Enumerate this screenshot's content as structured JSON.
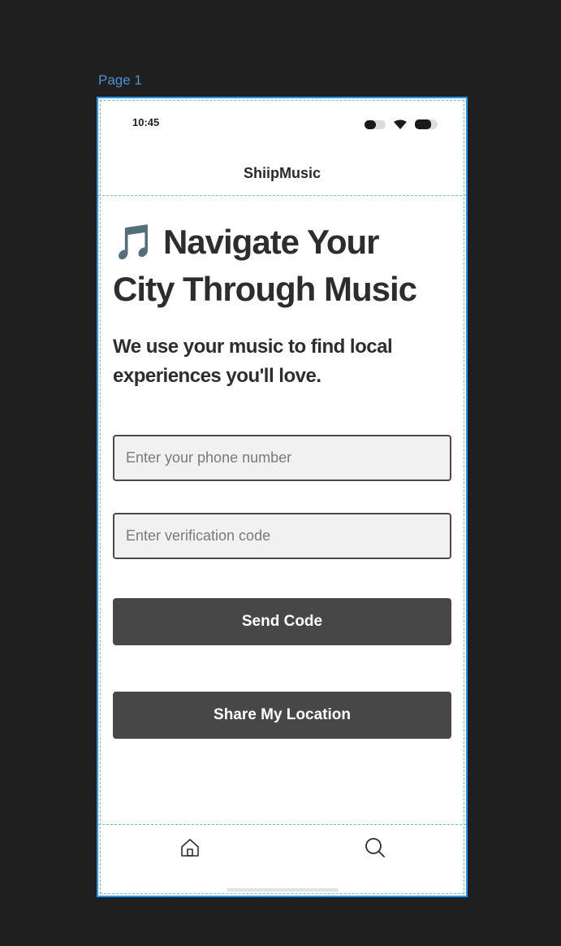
{
  "canvas": {
    "page_label": "Page 1"
  },
  "status_bar": {
    "time": "10:45",
    "icons": [
      "signal-icon",
      "wifi-icon",
      "battery-icon"
    ]
  },
  "header": {
    "title": "ShiipMusic"
  },
  "main": {
    "headline": "🎵 Navigate Your City Through Music",
    "subheadline": "We use your music to find local experiences you'll love.",
    "phone_input": {
      "value": "",
      "placeholder": "Enter your phone number"
    },
    "code_input": {
      "value": "",
      "placeholder": "Enter verification code"
    },
    "send_code_label": "Send Code",
    "share_location_label": "Share My Location"
  },
  "bottom_nav": {
    "items": [
      "home-icon",
      "search-icon"
    ]
  },
  "colors": {
    "canvas_background": "#1f1f1f",
    "frame_selection": "#2196f3",
    "button_background": "#474747",
    "input_background": "#f1f1f1",
    "text_primary": "#2d2d2d"
  }
}
